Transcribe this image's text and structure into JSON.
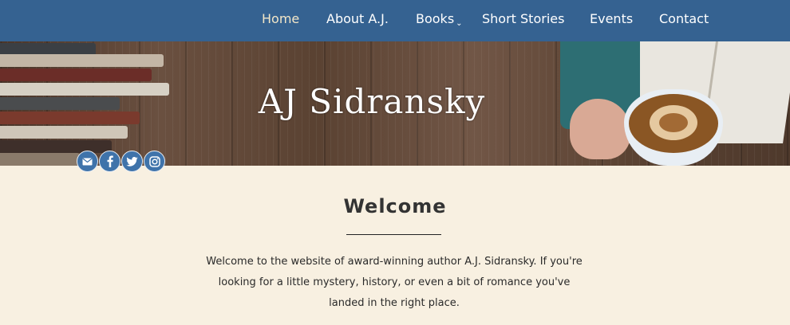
{
  "nav": {
    "items": [
      {
        "label": "Home",
        "active": true
      },
      {
        "label": "About A.J.",
        "active": false
      },
      {
        "label": "Books",
        "active": false,
        "has_dropdown": true
      },
      {
        "label": "Short Stories",
        "active": false
      },
      {
        "label": "Events",
        "active": false
      },
      {
        "label": "Contact",
        "active": false
      }
    ],
    "dropdown_icon": "chevron-down-icon"
  },
  "hero": {
    "title": "AJ Sidransky"
  },
  "social": {
    "icons": [
      "email-icon",
      "facebook-icon",
      "twitter-icon",
      "instagram-icon"
    ]
  },
  "main": {
    "heading": "Welcome",
    "intro": "Welcome to the website of award-winning author A.J. Sidransky. If you're looking for a little mystery, history, or even a bit of romance you've landed in the right place."
  },
  "colors": {
    "nav_background": "#356291",
    "active_nav_text": "#f2e6c8",
    "page_background": "#f8f0e1",
    "social_button": "#3f73aa"
  }
}
